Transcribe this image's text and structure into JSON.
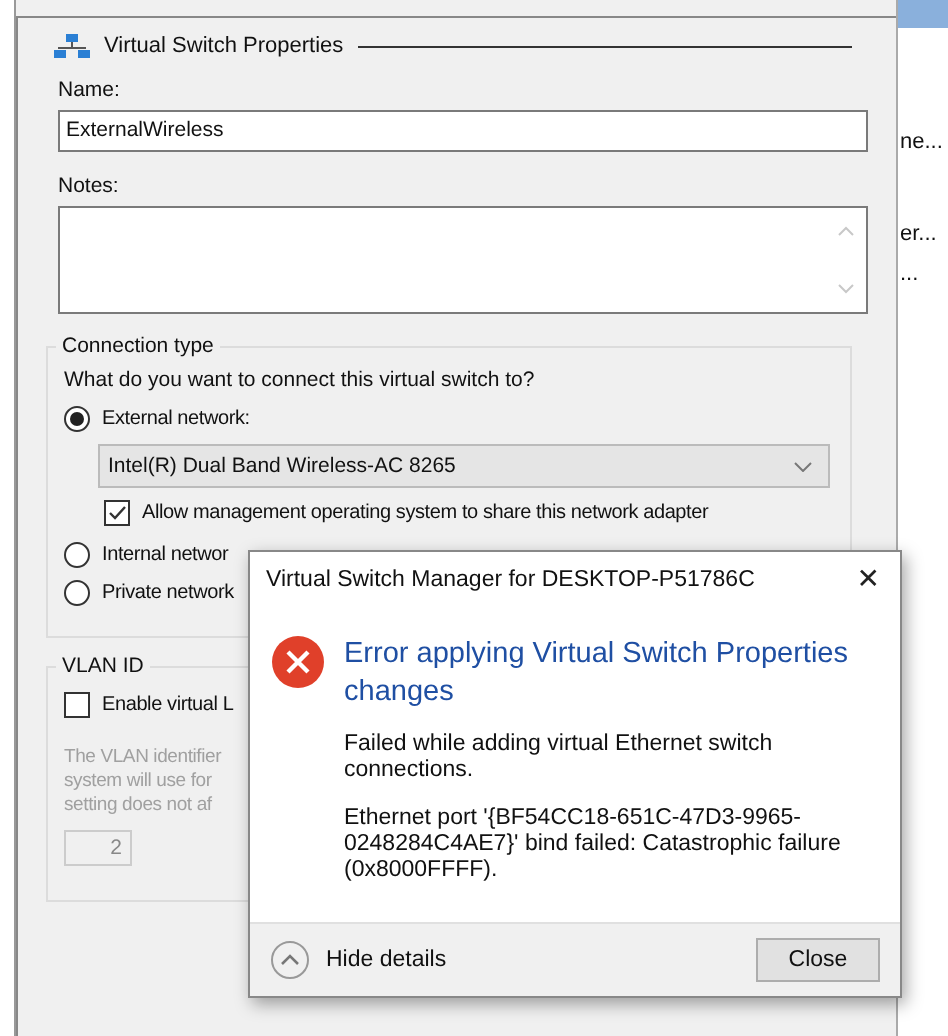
{
  "panel": {
    "title": "Virtual Switch Properties",
    "name_label": "Name:",
    "name_value": "ExternalWireless",
    "notes_label": "Notes:"
  },
  "connection": {
    "legend": "Connection type",
    "question": "What do you want to connect this virtual switch to?",
    "options": [
      {
        "label": "External network:",
        "selected": true
      },
      {
        "label": "Internal networ",
        "selected": false
      },
      {
        "label": "Private network",
        "selected": false
      }
    ],
    "adapter": "Intel(R) Dual Band Wireless-AC 8265",
    "share": {
      "label": "Allow management operating system to share this network adapter",
      "checked": true
    }
  },
  "vlan": {
    "legend": "VLAN ID",
    "enable": {
      "label": "Enable virtual L",
      "checked": false
    },
    "description": [
      "The VLAN identifier",
      "system will use for",
      "setting does not af"
    ],
    "value": "2"
  },
  "side_list": [
    "ne...",
    "er...",
    "..."
  ],
  "dialog": {
    "title": "Virtual Switch Manager for DESKTOP-P51786C",
    "close_glyph": "✕",
    "heading": "Error applying Virtual Switch Properties changes",
    "messages": [
      "Failed while adding virtual Ethernet switch connections.",
      "Ethernet port '{BF54CC18-651C-47D3-9965-0248284C4AE7}' bind failed: Catastrophic failure (0x8000FFFF)."
    ],
    "details": "Hide details",
    "button": "Close"
  }
}
